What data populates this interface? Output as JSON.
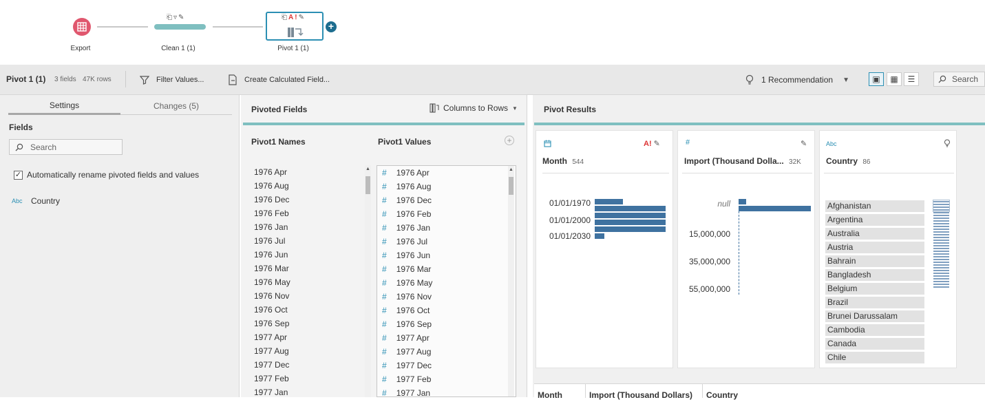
{
  "flow": {
    "nodes": [
      {
        "label": "Export"
      },
      {
        "label": "Clean 1 (1)"
      },
      {
        "label": "Pivot 1 (1)"
      }
    ]
  },
  "toolbar": {
    "title": "Pivot 1 (1)",
    "fields": "3 fields",
    "rows": "47K rows",
    "filter_label": "Filter Values...",
    "calc_label": "Create Calculated Field...",
    "recommendation": "1 Recommendation",
    "search_label": "Search"
  },
  "left": {
    "tabs": [
      "Settings",
      "Changes (5)"
    ],
    "fields_heading": "Fields",
    "search_placeholder": "Search",
    "auto_rename": "Automatically rename pivoted fields and values",
    "field_type": "Abc",
    "field_name": "Country"
  },
  "middle": {
    "title": "Pivoted Fields",
    "mode": "Columns to Rows",
    "names_header": "Pivot1 Names",
    "values_header": "Pivot1 Values",
    "names": [
      "1976 Apr",
      "1976 Aug",
      "1976 Dec",
      "1976 Feb",
      "1976 Jan",
      "1976 Jul",
      "1976 Jun",
      "1976 Mar",
      "1976 May",
      "1976 Nov",
      "1976 Oct",
      "1976 Sep",
      "1977 Apr",
      "1977 Aug",
      "1977 Dec",
      "1977 Feb",
      "1977 Jan"
    ],
    "values": [
      "1976 Apr",
      "1976 Aug",
      "1976 Dec",
      "1976 Feb",
      "1976 Jan",
      "1976 Jul",
      "1976 Jun",
      "1976 Mar",
      "1976 May",
      "1976 Nov",
      "1976 Oct",
      "1976 Sep",
      "1977 Apr",
      "1977 Aug",
      "1977 Dec",
      "1977 Feb",
      "1977 Jan"
    ]
  },
  "results": {
    "title": "Pivot Results",
    "cards": [
      {
        "type_icon": "calendar-icon",
        "name": "Month",
        "count": "544",
        "axis": [
          "01/01/1970",
          "01/01/2000",
          "01/01/2030"
        ],
        "bar_levels": [
          0.4,
          1.0,
          1.0,
          1.0,
          1.0,
          0.14
        ]
      },
      {
        "type_icon": "#",
        "name": "Import (Thousand Dolla...",
        "count": "32K",
        "axis": [
          "null",
          "15,000,000",
          "35,000,000",
          "55,000,000"
        ],
        "bar_levels": [
          0.1,
          1.0
        ]
      },
      {
        "type_icon": "Abc",
        "name": "Country",
        "count": "86",
        "items": [
          "Afghanistan",
          "Argentina",
          "Australia",
          "Austria",
          "Bahrain",
          "Bangladesh",
          "Belgium",
          "Brazil",
          "Brunei Darussalam",
          "Cambodia",
          "Canada",
          "Chile"
        ]
      }
    ],
    "grid_headers": [
      "Month",
      "Import (Thousand Dollars)",
      "Country"
    ]
  }
}
